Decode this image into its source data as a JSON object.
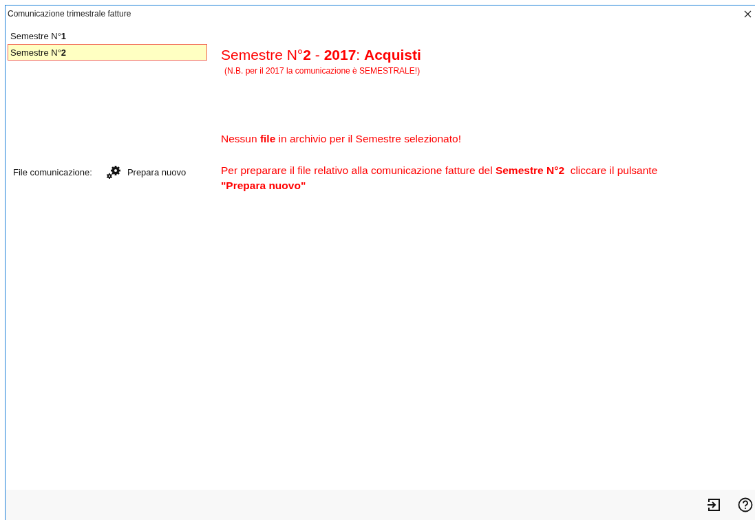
{
  "window": {
    "title": "Comunicazione trimestrale fatture"
  },
  "semesters": [
    {
      "label": "Semestre N°**1**",
      "selected": false
    },
    {
      "label": "Semestre N°**2**",
      "selected": true
    }
  ],
  "file_row": {
    "label": "File comunicazione:",
    "button": "Prepara nuovo"
  },
  "heading": "Semestre N°**2** - **2017**: **Acquisti**",
  "note": "(N.B. per il 2017 la comunicazione è SEMESTRALE!)",
  "messages": [
    "Nessun **file** in archivio per il Semestre selezionato!",
    "Per preparare il file relativo alla comunicazione fatture del **Semestre N°2**  cliccare il pulsante **\"Prepara nuovo\"**"
  ]
}
